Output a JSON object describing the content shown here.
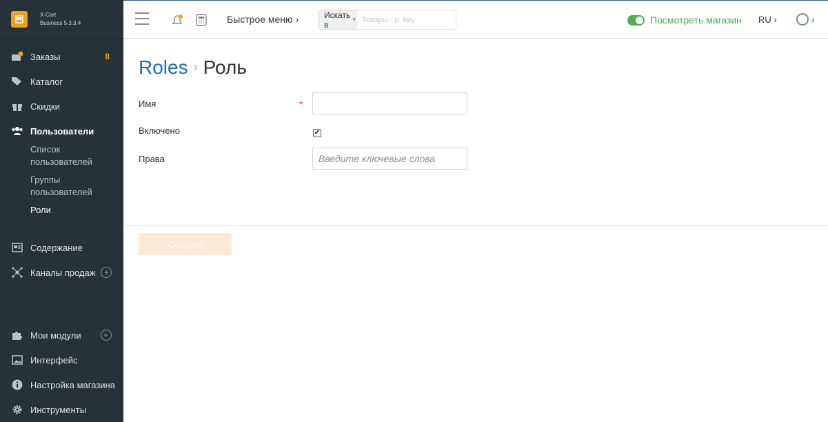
{
  "brand": {
    "line1": "X-Cart",
    "line2": "Business 5.3.3.4"
  },
  "sidebar": {
    "orders": {
      "label": "Заказы",
      "badge": "8"
    },
    "catalog": {
      "label": "Каталог"
    },
    "discounts": {
      "label": "Скидки"
    },
    "users": {
      "label": "Пользователи"
    },
    "users_sub": [
      {
        "label": "Список пользователей"
      },
      {
        "label": "Группы пользователей"
      },
      {
        "label": "Роли"
      }
    ],
    "content": {
      "label": "Содержание"
    },
    "channels": {
      "label": "Каналы продаж"
    },
    "modules": {
      "label": "Мои модули"
    },
    "interface": {
      "label": "Интерфейс"
    },
    "store_settings": {
      "label": "Настройка магазина"
    },
    "tools": {
      "label": "Инструменты"
    }
  },
  "topbar": {
    "quick_menu": "Быстрое меню ›",
    "search_in": "Искать в",
    "search_placeholder": "Товары - p: key",
    "view_store": "Посмотреть магазин",
    "lang": "RU ›",
    "user_caret": "›"
  },
  "breadcrumb": {
    "parent": "Roles",
    "separator": "›",
    "current": "Роль"
  },
  "form": {
    "name_label": "Имя",
    "name_value": "",
    "required_mark": "*",
    "enabled_label": "Включено",
    "enabled_checked": true,
    "rights_label": "Права",
    "rights_placeholder": "Введите ключевые слова",
    "create_button": "Создать"
  },
  "colors": {
    "sidebar_bg": "#263238",
    "accent_orange": "#f0a020",
    "link_blue": "#1b6cb0",
    "green": "#4caf50"
  }
}
